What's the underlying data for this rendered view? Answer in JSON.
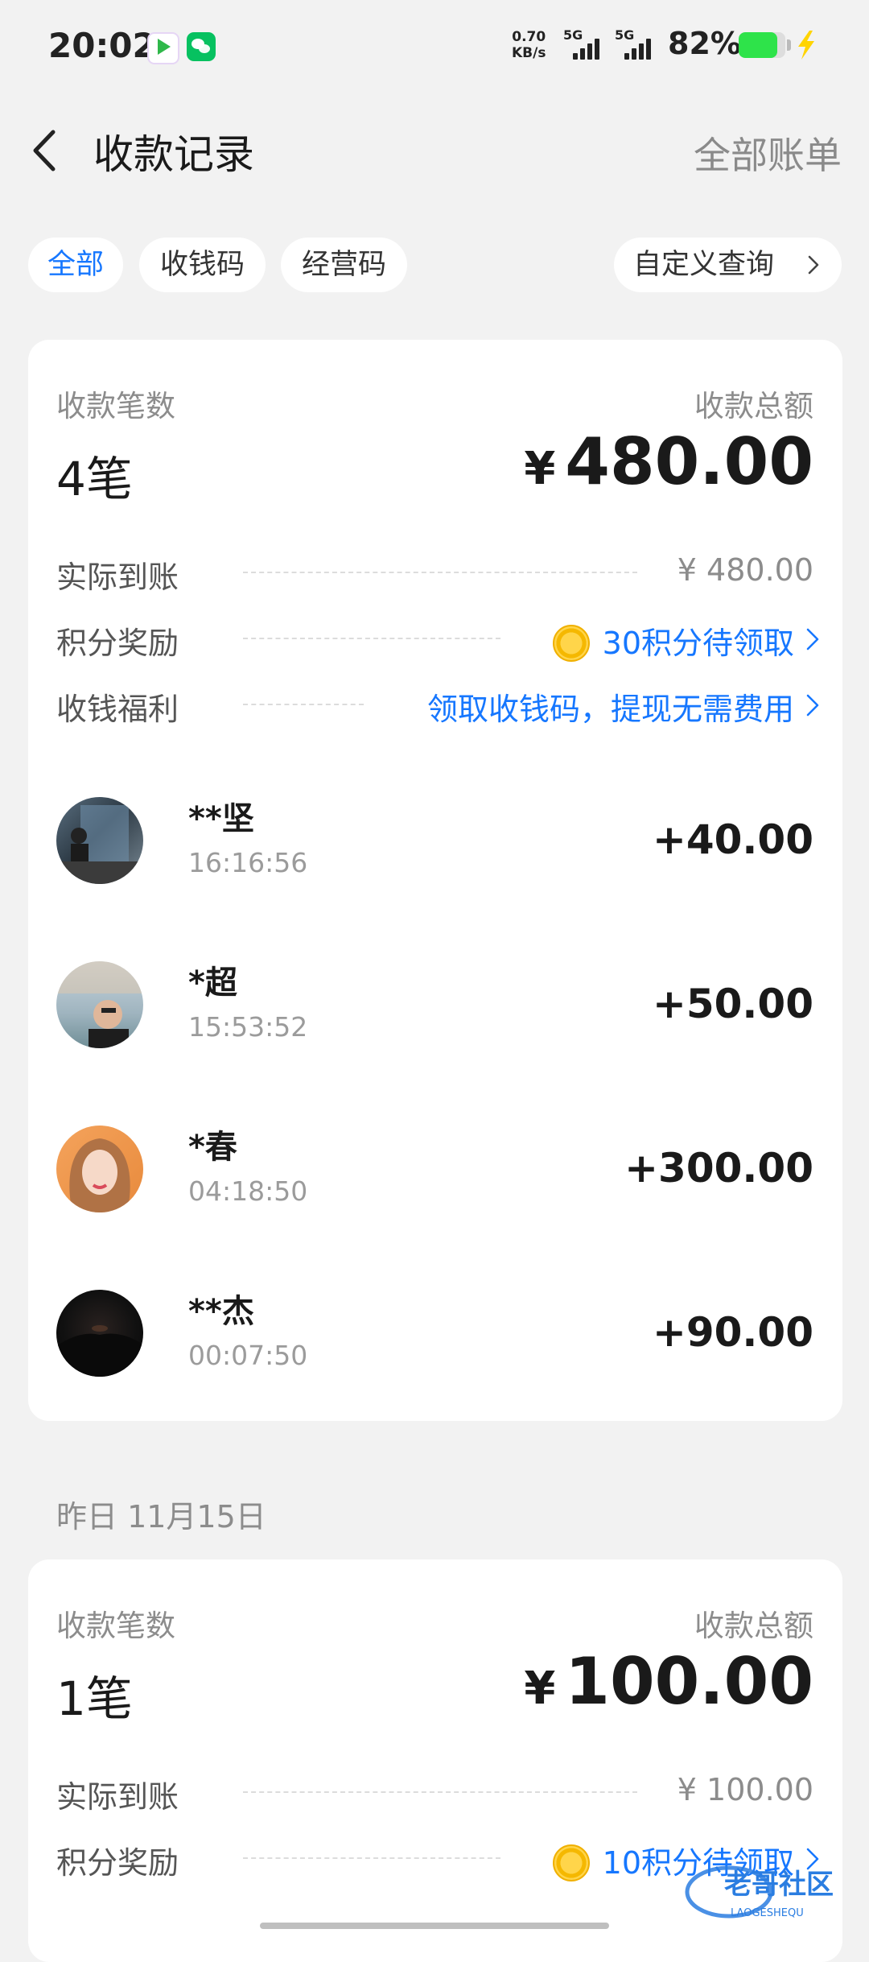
{
  "status_bar": {
    "time": "20:02",
    "net_speed_value": "0.70",
    "net_speed_unit": "KB/s",
    "signal_1": "5G",
    "signal_2": "5G",
    "battery_pct": "82%",
    "battery_level": 0.82,
    "battery_color": "#2ee34a"
  },
  "header": {
    "title": "收款记录",
    "all_bills": "全部账单"
  },
  "filters": {
    "chips": [
      "全部",
      "收钱码",
      "经营码"
    ],
    "active_index": 0,
    "custom_query": "自定义查询"
  },
  "today": {
    "count_label": "收款笔数",
    "total_label": "收款总额",
    "count": "4笔",
    "currency": "¥",
    "total": "480.00",
    "actual_label": "实际到账",
    "actual_value": "¥ 480.00",
    "points_label": "积分奖励",
    "points_value": "30积分待领取",
    "welfare_label": "收钱福利",
    "welfare_value": "领取收钱码，提现无需费用",
    "transactions": [
      {
        "name": "**坚",
        "time": "16:16:56",
        "amount": "+40.00"
      },
      {
        "name": "*超",
        "time": "15:53:52",
        "amount": "+50.00"
      },
      {
        "name": "*春",
        "time": "04:18:50",
        "amount": "+300.00"
      },
      {
        "name": "**杰",
        "time": "00:07:50",
        "amount": "+90.00"
      }
    ]
  },
  "yesterday": {
    "date_label": "昨日 11月15日",
    "count_label": "收款笔数",
    "total_label": "收款总额",
    "count": "1笔",
    "currency": "¥",
    "total": "100.00",
    "actual_label": "实际到账",
    "actual_value": "¥ 100.00",
    "points_label": "积分奖励",
    "points_value": "10积分待领取"
  },
  "watermark": {
    "text": "老哥社区",
    "subtext": "LAOGESHEQU"
  },
  "colors": {
    "accent": "#1677ff",
    "background": "#f2f2f2",
    "card": "#ffffff",
    "muted": "#8c8c8c"
  }
}
